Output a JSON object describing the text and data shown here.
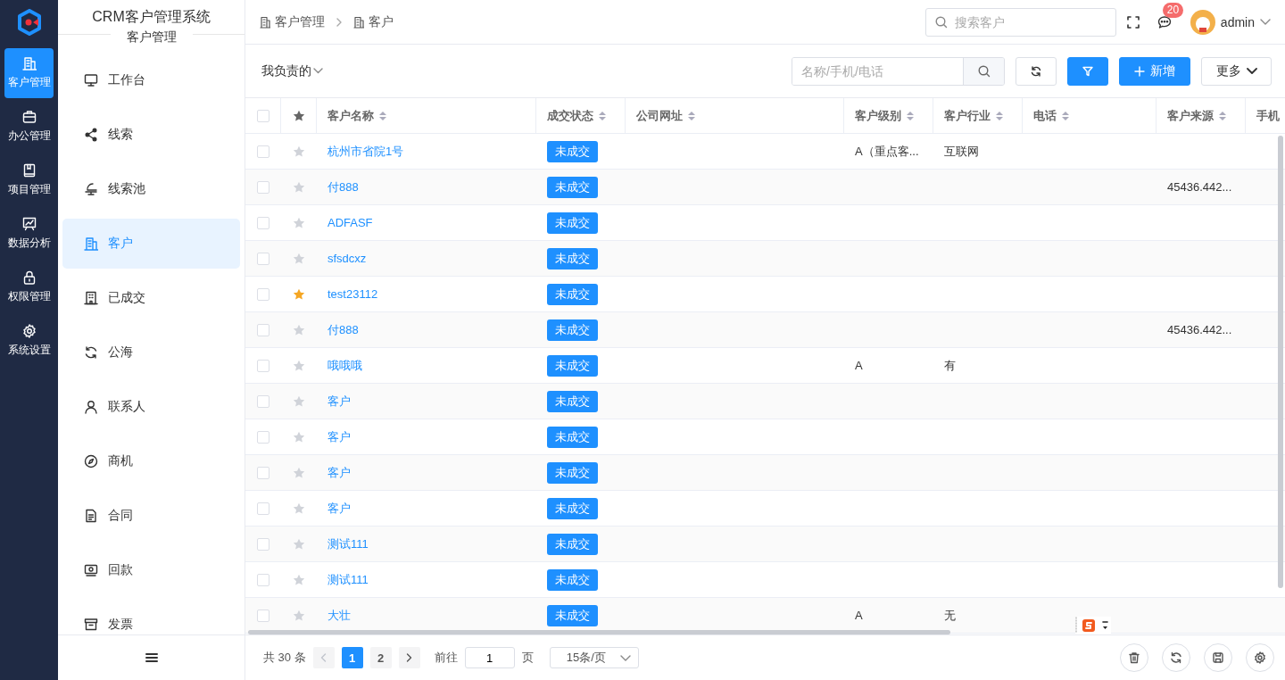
{
  "rail": {
    "items": [
      {
        "label": "客户管理",
        "selected": true
      },
      {
        "label": "办公管理",
        "selected": false
      },
      {
        "label": "项目管理",
        "selected": false
      },
      {
        "label": "数据分析",
        "selected": false
      },
      {
        "label": "权限管理",
        "selected": false
      },
      {
        "label": "系统设置",
        "selected": false
      }
    ]
  },
  "sidebar": {
    "title": "CRM客户管理系统",
    "section": "客户管理",
    "items": [
      {
        "label": "工作台",
        "selected": false
      },
      {
        "label": "线索",
        "selected": false
      },
      {
        "label": "线索池",
        "selected": false
      },
      {
        "label": "客户",
        "selected": true
      },
      {
        "label": "已成交",
        "selected": false
      },
      {
        "label": "公海",
        "selected": false
      },
      {
        "label": "联系人",
        "selected": false
      },
      {
        "label": "商机",
        "selected": false
      },
      {
        "label": "合同",
        "selected": false
      },
      {
        "label": "回款",
        "selected": false
      },
      {
        "label": "发票",
        "selected": false
      }
    ]
  },
  "header": {
    "breadcrumb": [
      "客户管理",
      "客户"
    ],
    "search": {
      "placeholder": "搜索客户"
    },
    "messages_badge": "20",
    "user": "admin"
  },
  "toolbar": {
    "scope": "我负责的",
    "search": {
      "placeholder": "名称/手机/电话"
    },
    "add_button": "新增",
    "more_button": "更多"
  },
  "table": {
    "all_checked": false,
    "columns": [
      {
        "label": "客户名称"
      },
      {
        "label": "成交状态"
      },
      {
        "label": "公司网址"
      },
      {
        "label": "客户级别"
      },
      {
        "label": "客户行业"
      },
      {
        "label": "电话"
      },
      {
        "label": "客户来源"
      },
      {
        "label": "手机"
      }
    ],
    "rows": [
      {
        "checked": false,
        "starred": false,
        "cells": [
          "杭州市省院1号",
          "未成交",
          null,
          "A（重点客...",
          "互联网",
          null,
          null,
          null
        ]
      },
      {
        "checked": false,
        "starred": false,
        "cells": [
          "付888",
          "未成交",
          null,
          null,
          null,
          null,
          "45436.442...",
          null
        ]
      },
      {
        "checked": false,
        "starred": false,
        "cells": [
          "ADFASF",
          "未成交",
          null,
          null,
          null,
          null,
          null,
          null
        ]
      },
      {
        "checked": false,
        "starred": false,
        "cells": [
          "sfsdcxz",
          "未成交",
          null,
          null,
          null,
          null,
          null,
          null
        ]
      },
      {
        "checked": false,
        "starred": true,
        "cells": [
          "test23112",
          "未成交",
          null,
          null,
          null,
          null,
          null,
          null
        ]
      },
      {
        "checked": false,
        "starred": false,
        "cells": [
          "付888",
          "未成交",
          null,
          null,
          null,
          null,
          "45436.442...",
          null
        ]
      },
      {
        "checked": false,
        "starred": false,
        "cells": [
          "哦哦哦",
          "未成交",
          null,
          "A",
          "有",
          null,
          null,
          null
        ]
      },
      {
        "checked": false,
        "starred": false,
        "cells": [
          "客户",
          "未成交",
          null,
          null,
          null,
          null,
          null,
          null
        ]
      },
      {
        "checked": false,
        "starred": false,
        "cells": [
          "客户",
          "未成交",
          null,
          null,
          null,
          null,
          null,
          null
        ]
      },
      {
        "checked": false,
        "starred": false,
        "cells": [
          "客户",
          "未成交",
          null,
          null,
          null,
          null,
          null,
          null
        ]
      },
      {
        "checked": false,
        "starred": false,
        "cells": [
          "客户",
          "未成交",
          null,
          null,
          null,
          null,
          null,
          null
        ]
      },
      {
        "checked": false,
        "starred": false,
        "cells": [
          "测试111",
          "未成交",
          null,
          null,
          null,
          null,
          null,
          null
        ]
      },
      {
        "checked": false,
        "starred": false,
        "cells": [
          "测试111",
          "未成交",
          null,
          null,
          null,
          null,
          null,
          null
        ]
      },
      {
        "checked": false,
        "starred": false,
        "cells": [
          "大壮",
          "未成交",
          null,
          "A",
          "无",
          null,
          null,
          null
        ]
      }
    ]
  },
  "pagination": {
    "total": "共 30 条",
    "pages": [
      {
        "label": "1",
        "selected": true
      },
      {
        "label": "2",
        "selected": false
      }
    ],
    "goto_label": "前往",
    "goto_value": "1",
    "page_unit": "页",
    "page_size": "15条/页"
  }
}
